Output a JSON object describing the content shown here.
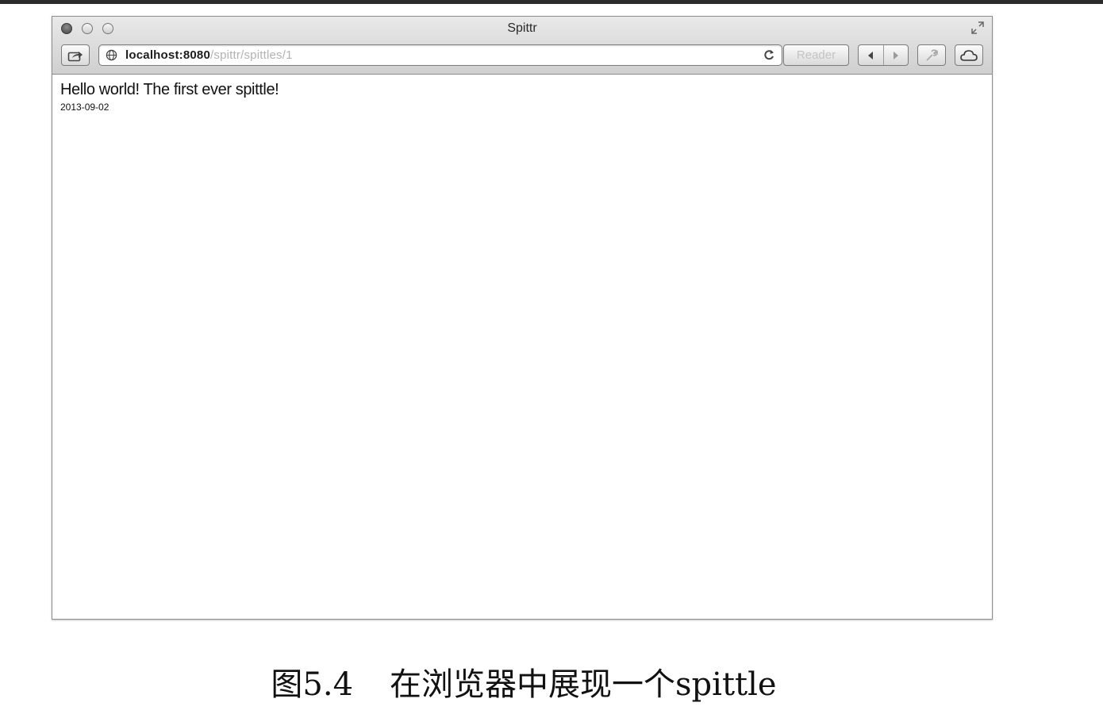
{
  "window": {
    "title": "Spittr",
    "url_host": "localhost:8080",
    "url_path": "/spittr/spittles/1",
    "reader_label": "Reader"
  },
  "page": {
    "message": "Hello world! The first ever spittle!",
    "time": "2013-09-02"
  },
  "caption": {
    "number": "图5.4",
    "text": "在浏览器中展现一个spittle"
  },
  "icons": {
    "close": "close-traffic-light",
    "minimize": "minimize-traffic-light",
    "zoom": "zoom-traffic-light",
    "fullscreen": "fullscreen-arrows-icon",
    "share": "share-icon",
    "globe": "globe-icon",
    "reload": "reload-icon",
    "back": "back-arrow-icon",
    "forward": "forward-arrow-icon",
    "tools": "wrench-icon",
    "cloud": "cloud-icon"
  }
}
